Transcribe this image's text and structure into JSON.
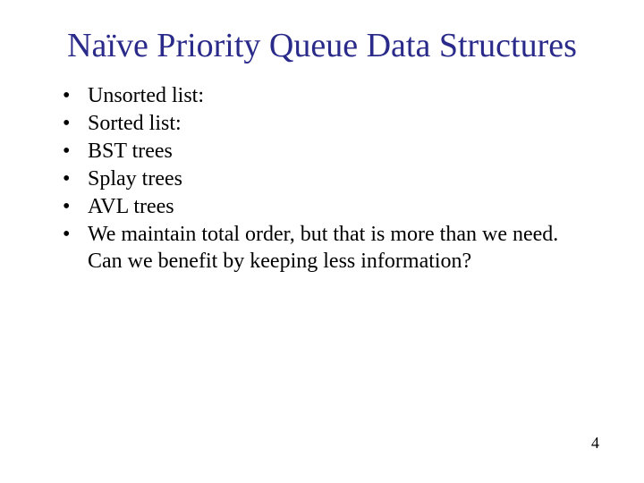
{
  "slide": {
    "title": "Naïve Priority Queue Data Structures",
    "bullets": [
      "Unsorted list:",
      "Sorted list:",
      "BST trees",
      "Splay trees",
      "AVL trees",
      "We maintain total order, but that is more than we need.  Can we benefit by keeping less information?"
    ],
    "page_number": "4"
  }
}
